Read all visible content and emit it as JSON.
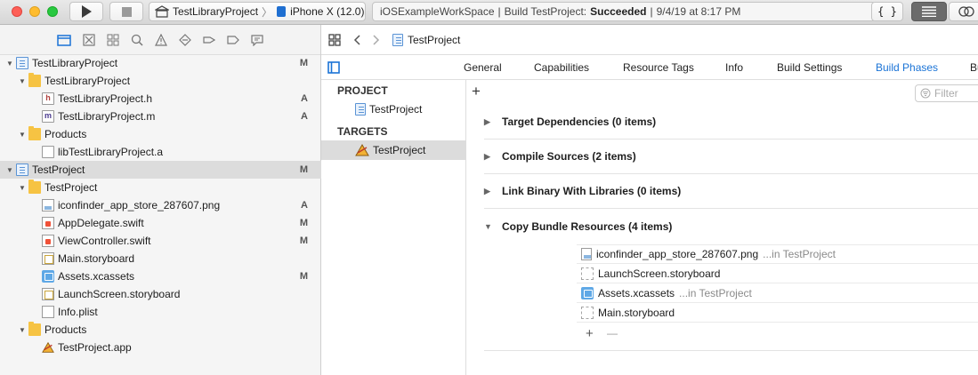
{
  "toolbar": {
    "scheme": {
      "project": "TestLibraryProject",
      "device": "iPhone X (12.0)"
    },
    "activity": {
      "workspace": "iOSExampleWorkSpace",
      "separator": "|",
      "build_label": "Build TestProject:",
      "build_status": "Succeeded",
      "date_sep": "|",
      "datetime": "9/4/19 at 8:17 PM"
    },
    "icons": [
      "play-icon",
      "stop-icon",
      "code-review-icon",
      "editor-standard-icon",
      "editor-assistant-icon"
    ]
  },
  "navigator": {
    "icons": [
      "folder-icon",
      "source-control-icon",
      "symbol-icon",
      "find-icon",
      "issue-icon",
      "test-icon",
      "debug-icon",
      "breakpoint-icon",
      "report-icon"
    ],
    "items": [
      {
        "label": "TestLibraryProject",
        "status": "M"
      },
      {
        "label": "TestLibraryProject",
        "status": ""
      },
      {
        "label": "TestLibraryProject.h",
        "status": "A"
      },
      {
        "label": "TestLibraryProject.m",
        "status": "A"
      },
      {
        "label": "Products",
        "status": ""
      },
      {
        "label": "libTestLibraryProject.a",
        "status": ""
      },
      {
        "label": "TestProject",
        "status": "M"
      },
      {
        "label": "TestProject",
        "status": ""
      },
      {
        "label": "iconfinder_app_store_287607.png",
        "status": "A"
      },
      {
        "label": "AppDelegate.swift",
        "status": "M"
      },
      {
        "label": "ViewController.swift",
        "status": "M"
      },
      {
        "label": "Main.storyboard",
        "status": ""
      },
      {
        "label": "Assets.xcassets",
        "status": "M"
      },
      {
        "label": "LaunchScreen.storyboard",
        "status": ""
      },
      {
        "label": "Info.plist",
        "status": ""
      },
      {
        "label": "Products",
        "status": ""
      },
      {
        "label": "TestProject.app",
        "status": ""
      }
    ]
  },
  "editor": {
    "jump": {
      "title": "TestProject"
    },
    "tabs": [
      "General",
      "Capabilities",
      "Resource Tags",
      "Info",
      "Build Settings",
      "Build Phases",
      "Bu"
    ],
    "targets_list": {
      "project_header": "PROJECT",
      "project_item": "TestProject",
      "targets_header": "TARGETS",
      "target_item": "TestProject"
    },
    "filter_placeholder": "Filter",
    "phases": [
      "Target Dependencies (0 items)",
      "Compile Sources (2 items)",
      "Link Binary With Libraries (0 items)",
      "Copy Bundle Resources (4 items)"
    ],
    "resources": [
      {
        "name": "iconfinder_app_store_287607.png",
        "location": "...in TestProject"
      },
      {
        "name": "LaunchScreen.storyboard",
        "location": ""
      },
      {
        "name": "Assets.xcassets",
        "location": "...in TestProject"
      },
      {
        "name": "Main.storyboard",
        "location": ""
      }
    ],
    "add_symbol": "+",
    "remove_symbol": "—"
  }
}
